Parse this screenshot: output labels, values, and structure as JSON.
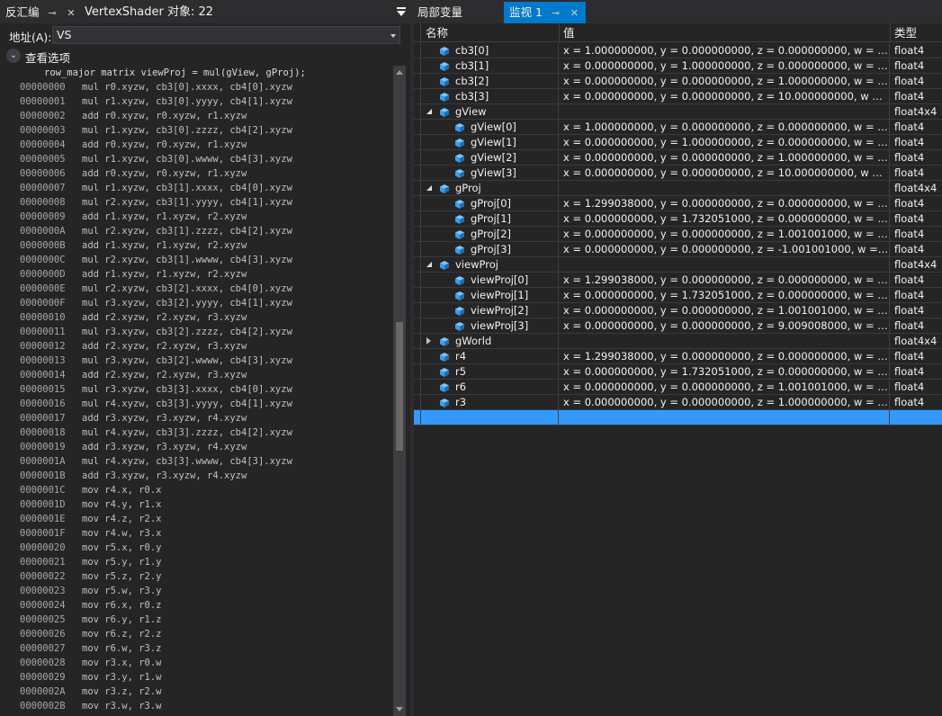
{
  "left_pane": {
    "tab": {
      "label": "反汇编"
    },
    "doc_title": "VertexShader 对象: 22",
    "address": {
      "label": "地址(A):",
      "value": "VS"
    },
    "view_options": "查看选项",
    "source_line": "row_major matrix viewProj = mul(gView, gProj);",
    "lines": [
      {
        "addr": "00000000",
        "inst": "mul r0.xyzw, cb3[0].xxxx, cb4[0].xyzw"
      },
      {
        "addr": "00000001",
        "inst": "mul r1.xyzw, cb3[0].yyyy, cb4[1].xyzw"
      },
      {
        "addr": "00000002",
        "inst": "add r0.xyzw, r0.xyzw, r1.xyzw"
      },
      {
        "addr": "00000003",
        "inst": "mul r1.xyzw, cb3[0].zzzz, cb4[2].xyzw"
      },
      {
        "addr": "00000004",
        "inst": "add r0.xyzw, r0.xyzw, r1.xyzw"
      },
      {
        "addr": "00000005",
        "inst": "mul r1.xyzw, cb3[0].wwww, cb4[3].xyzw"
      },
      {
        "addr": "00000006",
        "inst": "add r0.xyzw, r0.xyzw, r1.xyzw"
      },
      {
        "addr": "00000007",
        "inst": "mul r1.xyzw, cb3[1].xxxx, cb4[0].xyzw"
      },
      {
        "addr": "00000008",
        "inst": "mul r2.xyzw, cb3[1].yyyy, cb4[1].xyzw"
      },
      {
        "addr": "00000009",
        "inst": "add r1.xyzw, r1.xyzw, r2.xyzw"
      },
      {
        "addr": "0000000A",
        "inst": "mul r2.xyzw, cb3[1].zzzz, cb4[2].xyzw"
      },
      {
        "addr": "0000000B",
        "inst": "add r1.xyzw, r1.xyzw, r2.xyzw"
      },
      {
        "addr": "0000000C",
        "inst": "mul r2.xyzw, cb3[1].wwww, cb4[3].xyzw"
      },
      {
        "addr": "0000000D",
        "inst": "add r1.xyzw, r1.xyzw, r2.xyzw"
      },
      {
        "addr": "0000000E",
        "inst": "mul r2.xyzw, cb3[2].xxxx, cb4[0].xyzw"
      },
      {
        "addr": "0000000F",
        "inst": "mul r3.xyzw, cb3[2].yyyy, cb4[1].xyzw"
      },
      {
        "addr": "00000010",
        "inst": "add r2.xyzw, r2.xyzw, r3.xyzw"
      },
      {
        "addr": "00000011",
        "inst": "mul r3.xyzw, cb3[2].zzzz, cb4[2].xyzw"
      },
      {
        "addr": "00000012",
        "inst": "add r2.xyzw, r2.xyzw, r3.xyzw"
      },
      {
        "addr": "00000013",
        "inst": "mul r3.xyzw, cb3[2].wwww, cb4[3].xyzw"
      },
      {
        "addr": "00000014",
        "inst": "add r2.xyzw, r2.xyzw, r3.xyzw"
      },
      {
        "addr": "00000015",
        "inst": "mul r3.xyzw, cb3[3].xxxx, cb4[0].xyzw"
      },
      {
        "addr": "00000016",
        "inst": "mul r4.xyzw, cb3[3].yyyy, cb4[1].xyzw"
      },
      {
        "addr": "00000017",
        "inst": "add r3.xyzw, r3.xyzw, r4.xyzw"
      },
      {
        "addr": "00000018",
        "inst": "mul r4.xyzw, cb3[3].zzzz, cb4[2].xyzw"
      },
      {
        "addr": "00000019",
        "inst": "add r3.xyzw, r3.xyzw, r4.xyzw"
      },
      {
        "addr": "0000001A",
        "inst": "mul r4.xyzw, cb3[3].wwww, cb4[3].xyzw"
      },
      {
        "addr": "0000001B",
        "inst": "add r3.xyzw, r3.xyzw, r4.xyzw"
      },
      {
        "addr": "0000001C",
        "inst": "mov r4.x, r0.x"
      },
      {
        "addr": "0000001D",
        "inst": "mov r4.y, r1.x"
      },
      {
        "addr": "0000001E",
        "inst": "mov r4.z, r2.x"
      },
      {
        "addr": "0000001F",
        "inst": "mov r4.w, r3.x"
      },
      {
        "addr": "00000020",
        "inst": "mov r5.x, r0.y"
      },
      {
        "addr": "00000021",
        "inst": "mov r5.y, r1.y"
      },
      {
        "addr": "00000022",
        "inst": "mov r5.z, r2.y"
      },
      {
        "addr": "00000023",
        "inst": "mov r5.w, r3.y"
      },
      {
        "addr": "00000024",
        "inst": "mov r6.x, r0.z"
      },
      {
        "addr": "00000025",
        "inst": "mov r6.y, r1.z"
      },
      {
        "addr": "00000026",
        "inst": "mov r6.z, r2.z"
      },
      {
        "addr": "00000027",
        "inst": "mov r6.w, r3.z"
      },
      {
        "addr": "00000028",
        "inst": "mov r3.x, r0.w"
      },
      {
        "addr": "00000029",
        "inst": "mov r3.y, r1.w"
      },
      {
        "addr": "0000002A",
        "inst": "mov r3.z, r2.w"
      },
      {
        "addr": "0000002B",
        "inst": "mov r3.w, r3.w"
      }
    ]
  },
  "right_pane": {
    "tabs": [
      {
        "label": "局部变量"
      },
      {
        "label": "监视 1"
      }
    ],
    "headers": {
      "name": "名称",
      "value": "值",
      "type": "类型"
    },
    "rows": [
      {
        "depth": 1,
        "exp": "",
        "name": "cb3[0]",
        "value": "x = 1.000000000, y = 0.000000000, z = 0.000000000, w = 0.000000000,...",
        "type": "float4"
      },
      {
        "depth": 1,
        "exp": "",
        "name": "cb3[1]",
        "value": "x = 0.000000000, y = 1.000000000, z = 0.000000000, w = 0.000000000,...",
        "type": "float4"
      },
      {
        "depth": 1,
        "exp": "",
        "name": "cb3[2]",
        "value": "x = 0.000000000, y = 0.000000000, z = 1.000000000, w = 0.000000000,...",
        "type": "float4"
      },
      {
        "depth": 1,
        "exp": "",
        "name": "cb3[3]",
        "value": "x = 0.000000000, y = 0.000000000, z = 10.000000000, w = 1.0000000...",
        "type": "float4"
      },
      {
        "depth": 1,
        "exp": "open",
        "name": "gView",
        "value": "",
        "type": "float4x4"
      },
      {
        "depth": 2,
        "exp": "",
        "name": "gView[0]",
        "value": "x = 1.000000000, y = 0.000000000, z = 0.000000000, w = 0.000000000",
        "type": "float4"
      },
      {
        "depth": 2,
        "exp": "",
        "name": "gView[1]",
        "value": "x = 0.000000000, y = 1.000000000, z = 0.000000000, w = 0.000000000",
        "type": "float4"
      },
      {
        "depth": 2,
        "exp": "",
        "name": "gView[2]",
        "value": "x = 0.000000000, y = 0.000000000, z = 1.000000000, w = 0.000000000",
        "type": "float4"
      },
      {
        "depth": 2,
        "exp": "",
        "name": "gView[3]",
        "value": "x = 0.000000000, y = 0.000000000, z = 10.000000000, w = 1.000000000",
        "type": "float4"
      },
      {
        "depth": 1,
        "exp": "open",
        "name": "gProj",
        "value": "",
        "type": "float4x4"
      },
      {
        "depth": 2,
        "exp": "",
        "name": "gProj[0]",
        "value": "x = 1.299038000, y = 0.000000000, z = 0.000000000, w = 0.000000000",
        "type": "float4"
      },
      {
        "depth": 2,
        "exp": "",
        "name": "gProj[1]",
        "value": "x = 0.000000000, y = 1.732051000, z = 0.000000000, w = 0.000000000",
        "type": "float4"
      },
      {
        "depth": 2,
        "exp": "",
        "name": "gProj[2]",
        "value": "x = 0.000000000, y = 0.000000000, z = 1.001001000, w = 1.000000000",
        "type": "float4"
      },
      {
        "depth": 2,
        "exp": "",
        "name": "gProj[3]",
        "value": "x = 0.000000000, y = 0.000000000, z = -1.001001000, w = 0.000000000",
        "type": "float4"
      },
      {
        "depth": 1,
        "exp": "open",
        "name": "viewProj",
        "value": "",
        "type": "float4x4"
      },
      {
        "depth": 2,
        "exp": "",
        "name": "viewProj[0]",
        "value": "x = 1.299038000, y = 0.000000000, z = 0.000000000, w = 0.000000000",
        "type": "float4"
      },
      {
        "depth": 2,
        "exp": "",
        "name": "viewProj[1]",
        "value": "x = 0.000000000, y = 1.732051000, z = 0.000000000, w = 0.000000000",
        "type": "float4"
      },
      {
        "depth": 2,
        "exp": "",
        "name": "viewProj[2]",
        "value": "x = 0.000000000, y = 0.000000000, z = 1.001001000, w = 1.000000000",
        "type": "float4"
      },
      {
        "depth": 2,
        "exp": "",
        "name": "viewProj[3]",
        "value": "x = 0.000000000, y = 0.000000000, z = 9.009008000, w = 10.000000000",
        "type": "float4"
      },
      {
        "depth": 1,
        "exp": "closed",
        "name": "gWorld",
        "value": "",
        "type": "float4x4"
      },
      {
        "depth": 1,
        "exp": "",
        "name": "r4",
        "value": "x = 1.299038000, y = 0.000000000, z = 0.000000000, w = 0.000000000,...",
        "type": "float4"
      },
      {
        "depth": 1,
        "exp": "",
        "name": "r5",
        "value": "x = 0.000000000, y = 1.732051000, z = 0.000000000, w = 0.000000000,...",
        "type": "float4"
      },
      {
        "depth": 1,
        "exp": "",
        "name": "r6",
        "value": "x = 0.000000000, y = 0.000000000, z = 1.001001000, w = 9.009008000,...",
        "type": "float4"
      },
      {
        "depth": 1,
        "exp": "",
        "name": "r3",
        "value": "x = 0.000000000, y = 0.000000000, z = 1.000000000, w = 10.00000000...",
        "type": "float4"
      }
    ]
  },
  "colors": {
    "accent": "#007acc",
    "selection": "#3399ff",
    "variable_icon": "#3c9ee8"
  }
}
